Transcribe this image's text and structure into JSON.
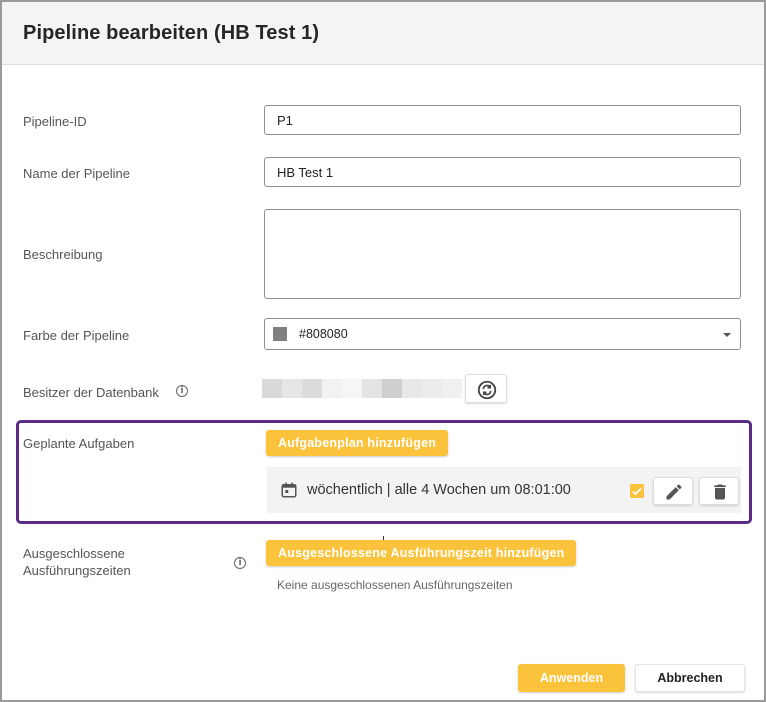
{
  "dialog": {
    "title": "Pipeline bearbeiten (HB Test 1)"
  },
  "fields": {
    "pipeline_id": {
      "label": "Pipeline-ID",
      "value": "P1"
    },
    "name": {
      "label": "Name der Pipeline",
      "value": "HB Test 1"
    },
    "description": {
      "label": "Beschreibung",
      "value": ""
    },
    "color": {
      "label": "Farbe der Pipeline",
      "value": "#808080",
      "swatch": "#808080"
    },
    "owner": {
      "label": "Besitzer der Datenbank"
    }
  },
  "scheduled": {
    "label": "Geplante Aufgaben",
    "add_button": "Aufgabenplan hinzufügen",
    "items": [
      {
        "text": "wöchentlich | alle 4 Wochen um 08:01:00",
        "enabled": true
      }
    ]
  },
  "excluded": {
    "label_line1": "Ausgeschlossene",
    "label_line2": "Ausführungszeiten",
    "add_button": "Ausgeschlossene Ausführungszeit hinzufügen",
    "empty_text": "Keine ausgeschlossenen Ausführungszeiten"
  },
  "footer": {
    "apply": "Anwenden",
    "cancel": "Abbrechen"
  },
  "colors": {
    "accent": "#fbc33c",
    "highlight_border": "#5c2a82"
  },
  "icons": {
    "info": "info-icon",
    "refresh": "refresh-icon",
    "calendar": "calendar-icon",
    "edit": "pencil-icon",
    "delete": "trash-icon",
    "check": "check-icon"
  }
}
